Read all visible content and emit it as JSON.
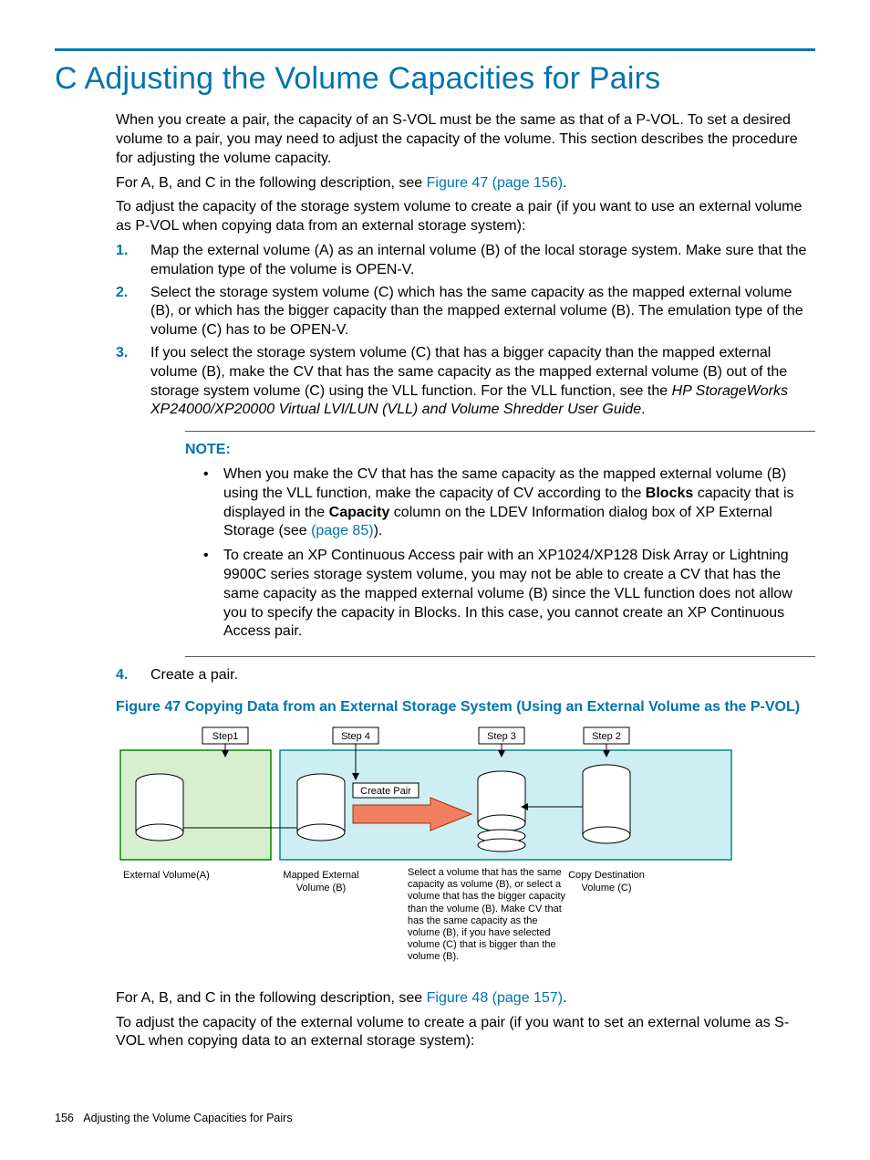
{
  "heading": "C Adjusting the Volume Capacities for Pairs",
  "intro": "When you create a pair, the capacity of an S-VOL must be the same as that of a P-VOL. To set a desired volume to a pair, you may need to adjust the capacity of the volume. This section describes the procedure for adjusting the volume capacity.",
  "see1_pre": "For A, B, and C in the following description, see ",
  "see1_link": "Figure 47 (page 156)",
  "see1_post": ".",
  "adjust1": "To adjust the capacity of the storage system volume to create a pair (if you want to use an external volume as P-VOL when copying data from an external storage system):",
  "steps": {
    "m1": "1.",
    "s1": "Map the external volume (A) as an internal volume (B) of the local storage system. Make sure that the emulation type of the volume is OPEN-V.",
    "m2": "2.",
    "s2": "Select the storage system volume (C) which has the same capacity as the mapped external volume (B), or which has the bigger capacity than the mapped external volume (B). The emulation type of the volume (C) has to be OPEN-V.",
    "m3": "3.",
    "s3a": "If you select the storage system volume (C) that has a bigger capacity than the mapped external volume (B), make the CV that has the same capacity as the mapped external volume (B) out of the storage system volume (C) using the VLL function. For the VLL function, see the ",
    "s3b": "HP StorageWorks XP24000/XP20000 Virtual LVI/LUN (VLL) and Volume Shredder User Guide",
    "s3c": ".",
    "m4": "4.",
    "s4": "Create a pair."
  },
  "note": {
    "head": "NOTE:",
    "b1a": "When you make the CV that has the same capacity as the mapped external volume (B) using the VLL function, make the capacity of CV according to the ",
    "b1_blocks": "Blocks",
    "b1b": " capacity that is displayed in the ",
    "b1_capacity": "Capacity",
    "b1c": " column on the LDEV Information dialog box of XP External Storage (see ",
    "b1_link": "(page 85)",
    "b1d": ").",
    "b2": "To create an XP Continuous Access pair with an XP1024/XP128 Disk Array or Lightning 9900C series storage system volume, you may not be able to create a CV that has the same capacity as the mapped external volume (B) since the VLL function does not allow you to specify the capacity in Blocks. In this case, you cannot create an XP Continuous Access pair."
  },
  "figure_title": "Figure 47 Copying Data from an External Storage System (Using an External Volume as the P-VOL)",
  "fig": {
    "step1": "Step1",
    "step2": "Step 2",
    "step3": "Step 3",
    "step4": "Step 4",
    "create_pair": "Create Pair",
    "ext_a": "External Volume(A)",
    "mapped_b": "Mapped External Volume (B)",
    "select_text": "Select a volume that has the same capacity as volume (B), or select a volume that has the bigger capacity than the volume (B). Make CV that has the same capacity as the volume (B), if you have selected volume (C) that is bigger than the volume (B).",
    "copy_dest": "Copy Destination Volume (C)"
  },
  "see2_pre": "For A, B, and C in the following description, see ",
  "see2_link": "Figure 48 (page 157)",
  "see2_post": ".",
  "adjust2": "To adjust the capacity of the external volume to create a pair (if you want to set an external volume as S-VOL when copying data to an external storage system):",
  "footer_page": "156",
  "footer_text": "Adjusting the Volume Capacities for Pairs"
}
